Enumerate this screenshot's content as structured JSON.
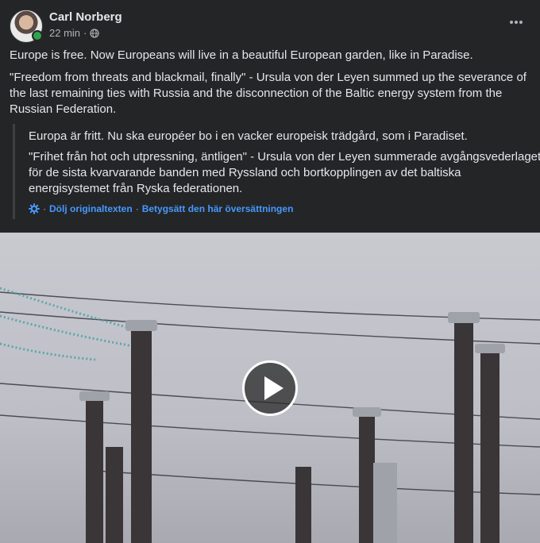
{
  "post": {
    "author": "Carl Norberg",
    "time": "22 min",
    "separator": "·",
    "privacy_icon": "globe-icon",
    "online": true,
    "text": [
      "Europe is free. Now Europeans will live in a beautiful European garden, like in Paradise.",
      " \"Freedom from threats and blackmail, finally\" - Ursula von der Leyen summed up the severance of the last remaining ties with Russia and the disconnection of the Baltic energy system from the Russian Federation."
    ]
  },
  "translation": {
    "paragraphs": [
      "Europa är fritt. Nu ska européer bo i en vacker europeisk trädgård, som i Paradiset.",
      "\"Frihet från hot och utpressning, äntligen\" - Ursula von der Leyen summerade avgångsvederlaget för de sista kvarvarande banden med Ryssland och bortkopplingen av det baltiska energisystemet från Ryska federationen."
    ],
    "hide_original": "Dölj originaltexten",
    "link_separator": "·",
    "rate_translation": "Betygsätt den här översättningen"
  },
  "video": {
    "play_icon": "play-icon"
  },
  "colors": {
    "background": "#242526",
    "link": "#4599ff",
    "online": "#31a24c"
  }
}
